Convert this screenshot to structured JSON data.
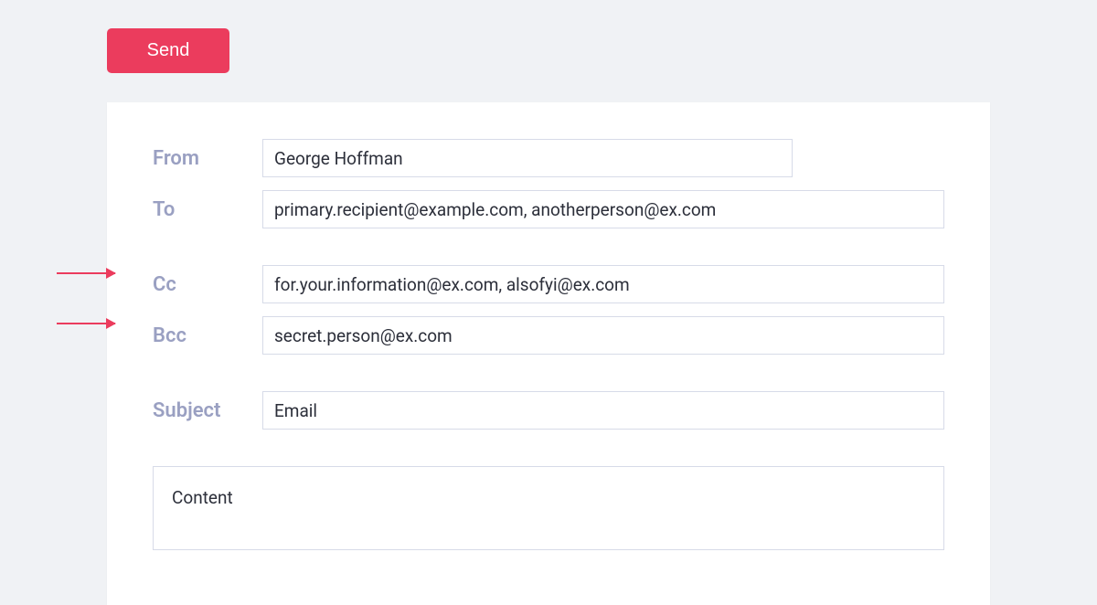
{
  "send_label": "Send",
  "labels": {
    "from": "From",
    "to": "To",
    "cc": "Cc",
    "bcc": "Bcc",
    "subject": "Subject"
  },
  "fields": {
    "from": "George Hoffman",
    "to": "primary.recipient@example.com, anotherperson@ex.com",
    "cc": "for.your.information@ex.com, alsofyi@ex.com",
    "bcc": "secret.person@ex.com",
    "subject": "Email",
    "content": "Content"
  }
}
